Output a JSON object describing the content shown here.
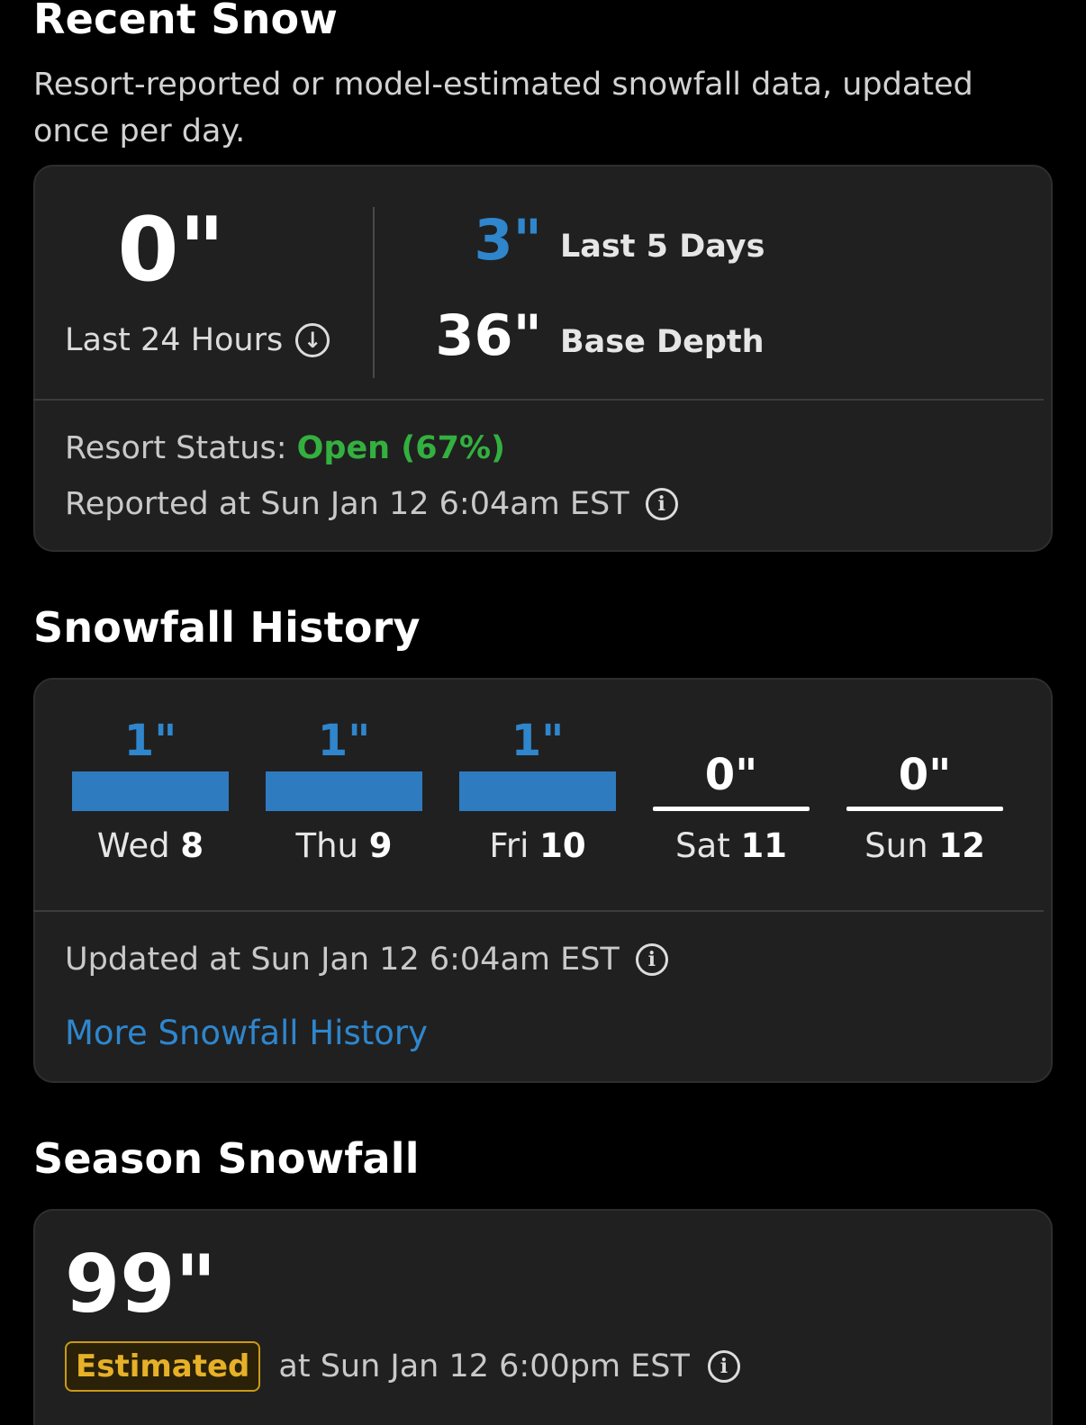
{
  "recent_snow": {
    "title": "Recent Snow",
    "subtitle": "Resort-reported or model-estimated snowfall data, updated once per day.",
    "last_24h_value": "0\"",
    "last_24h_label": "Last 24 Hours",
    "last_5_days_value": "3\"",
    "last_5_days_label": "Last 5 Days",
    "base_depth_value": "36\"",
    "base_depth_label": "Base Depth",
    "status_label": "Resort Status:",
    "status_value": "Open (67%)",
    "reported_at": "Reported at Sun Jan 12 6:04am EST",
    "info_glyph": "i",
    "download_glyph": "↓"
  },
  "snowfall_history": {
    "title": "Snowfall History",
    "days": [
      {
        "value": "1\"",
        "day": "Wed",
        "date": "8"
      },
      {
        "value": "1\"",
        "day": "Thu",
        "date": "9"
      },
      {
        "value": "1\"",
        "day": "Fri",
        "date": "10"
      },
      {
        "value": "0\"",
        "day": "Sat",
        "date": "11"
      },
      {
        "value": "0\"",
        "day": "Sun",
        "date": "12"
      }
    ],
    "updated_at": "Updated at Sun Jan 12 6:04am EST",
    "more_link": "More Snowfall History"
  },
  "season_snowfall": {
    "title": "Season Snowfall",
    "value": "99\"",
    "badge": "Estimated",
    "at_text": "at Sun Jan 12 6:00pm EST"
  },
  "colors": {
    "accent_blue": "#2f86cc",
    "open_green": "#33b03f",
    "estimated_gold": "#e6b128"
  }
}
